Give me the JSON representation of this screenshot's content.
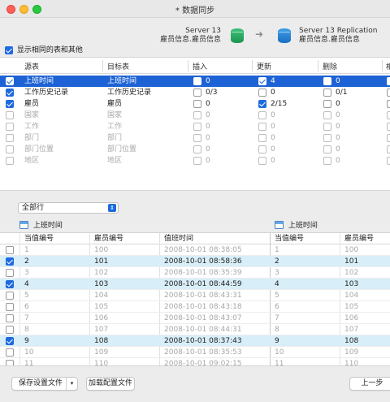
{
  "window": {
    "title": "* 数据同步"
  },
  "source": {
    "server": "Server 13",
    "table": "雇员信息.雇员信息"
  },
  "target": {
    "server": "Server 13 Replication",
    "table": "雇员信息.雇员信息"
  },
  "show_same_label": "显示相同的表和其他",
  "top_table": {
    "headers": [
      "源表",
      "目标表",
      "插入",
      "更新",
      "删除",
      "相"
    ],
    "rows": [
      {
        "checked": true,
        "src": "上班时间",
        "dst": "上班时间",
        "ins_on": false,
        "ins": "0",
        "upd_on": true,
        "upd": "4",
        "del_on": false,
        "del": "0",
        "selected": true,
        "disabled": false
      },
      {
        "checked": true,
        "src": "工作历史记录",
        "dst": "工作历史记录",
        "ins_on": false,
        "ins": "0/3",
        "upd_on": false,
        "upd": "0",
        "del_on": false,
        "del": "0/1",
        "selected": false,
        "disabled": false
      },
      {
        "checked": true,
        "src": "雇员",
        "dst": "雇员",
        "ins_on": false,
        "ins": "0",
        "upd_on": true,
        "upd": "2/15",
        "del_on": false,
        "del": "0",
        "selected": false,
        "disabled": false
      },
      {
        "checked": false,
        "src": "国家",
        "dst": "国家",
        "ins_on": false,
        "ins": "0",
        "upd_on": false,
        "upd": "0",
        "del_on": false,
        "del": "0",
        "selected": false,
        "disabled": true
      },
      {
        "checked": false,
        "src": "工作",
        "dst": "工作",
        "ins_on": false,
        "ins": "0",
        "upd_on": false,
        "upd": "0",
        "del_on": false,
        "del": "0",
        "selected": false,
        "disabled": true
      },
      {
        "checked": false,
        "src": "部门",
        "dst": "部门",
        "ins_on": false,
        "ins": "0",
        "upd_on": false,
        "upd": "0",
        "del_on": false,
        "del": "0",
        "selected": false,
        "disabled": true
      },
      {
        "checked": false,
        "src": "部门位置",
        "dst": "部门位置",
        "ins_on": false,
        "ins": "0",
        "upd_on": false,
        "upd": "0",
        "del_on": false,
        "del": "0",
        "selected": false,
        "disabled": true
      },
      {
        "checked": false,
        "src": "地区",
        "dst": "地区",
        "ins_on": false,
        "ins": "0",
        "upd_on": false,
        "upd": "0",
        "del_on": false,
        "del": "0",
        "selected": false,
        "disabled": true
      }
    ]
  },
  "filter": {
    "value": "全部行"
  },
  "left_table_title": "上班时间",
  "right_table_title": "上班时间",
  "bottom_table": {
    "headers_left": [
      "当值编号",
      "雇员编号",
      "值班时间"
    ],
    "headers_right": [
      "当值编号",
      "雇员编号"
    ],
    "rows": [
      {
        "checked": false,
        "id": "1",
        "emp": "100",
        "time": "2008-10-01 08:38:05",
        "rid": "1",
        "remp": "100",
        "hl": false
      },
      {
        "checked": true,
        "id": "2",
        "emp": "101",
        "time": "2008-10-01 08:58:36",
        "rid": "2",
        "remp": "101",
        "hl": true
      },
      {
        "checked": false,
        "id": "3",
        "emp": "102",
        "time": "2008-10-01 08:35:39",
        "rid": "3",
        "remp": "102",
        "hl": false
      },
      {
        "checked": true,
        "id": "4",
        "emp": "103",
        "time": "2008-10-01 08:44:59",
        "rid": "4",
        "remp": "103",
        "hl": true
      },
      {
        "checked": false,
        "id": "5",
        "emp": "104",
        "time": "2008-10-01 08:43:31",
        "rid": "5",
        "remp": "104",
        "hl": false
      },
      {
        "checked": false,
        "id": "6",
        "emp": "105",
        "time": "2008-10-01 08:43:18",
        "rid": "6",
        "remp": "105",
        "hl": false
      },
      {
        "checked": false,
        "id": "7",
        "emp": "106",
        "time": "2008-10-01 08:43:07",
        "rid": "7",
        "remp": "106",
        "hl": false
      },
      {
        "checked": false,
        "id": "8",
        "emp": "107",
        "time": "2008-10-01 08:44:31",
        "rid": "8",
        "remp": "107",
        "hl": false
      },
      {
        "checked": true,
        "id": "9",
        "emp": "108",
        "time": "2008-10-01 08:37:43",
        "rid": "9",
        "remp": "108",
        "hl": true
      },
      {
        "checked": false,
        "id": "10",
        "emp": "109",
        "time": "2008-10-01 08:35:53",
        "rid": "10",
        "remp": "109",
        "hl": false
      },
      {
        "checked": false,
        "id": "11",
        "emp": "110",
        "time": "2008-10-01 09:02:15",
        "rid": "11",
        "remp": "110",
        "hl": false
      }
    ]
  },
  "footer": {
    "save_label": "保存设置文件",
    "load_label": "加载配置文件",
    "prev_label": "上一步"
  },
  "colors": {
    "selection": "#1e63d5",
    "highlight": "#d8eef9",
    "accent": "#1e6ae0"
  },
  "icons": {
    "source_db": "green-database-icon",
    "target_db": "blue-database-icon",
    "arrow": "arrow-right-icon",
    "table": "table-icon"
  }
}
